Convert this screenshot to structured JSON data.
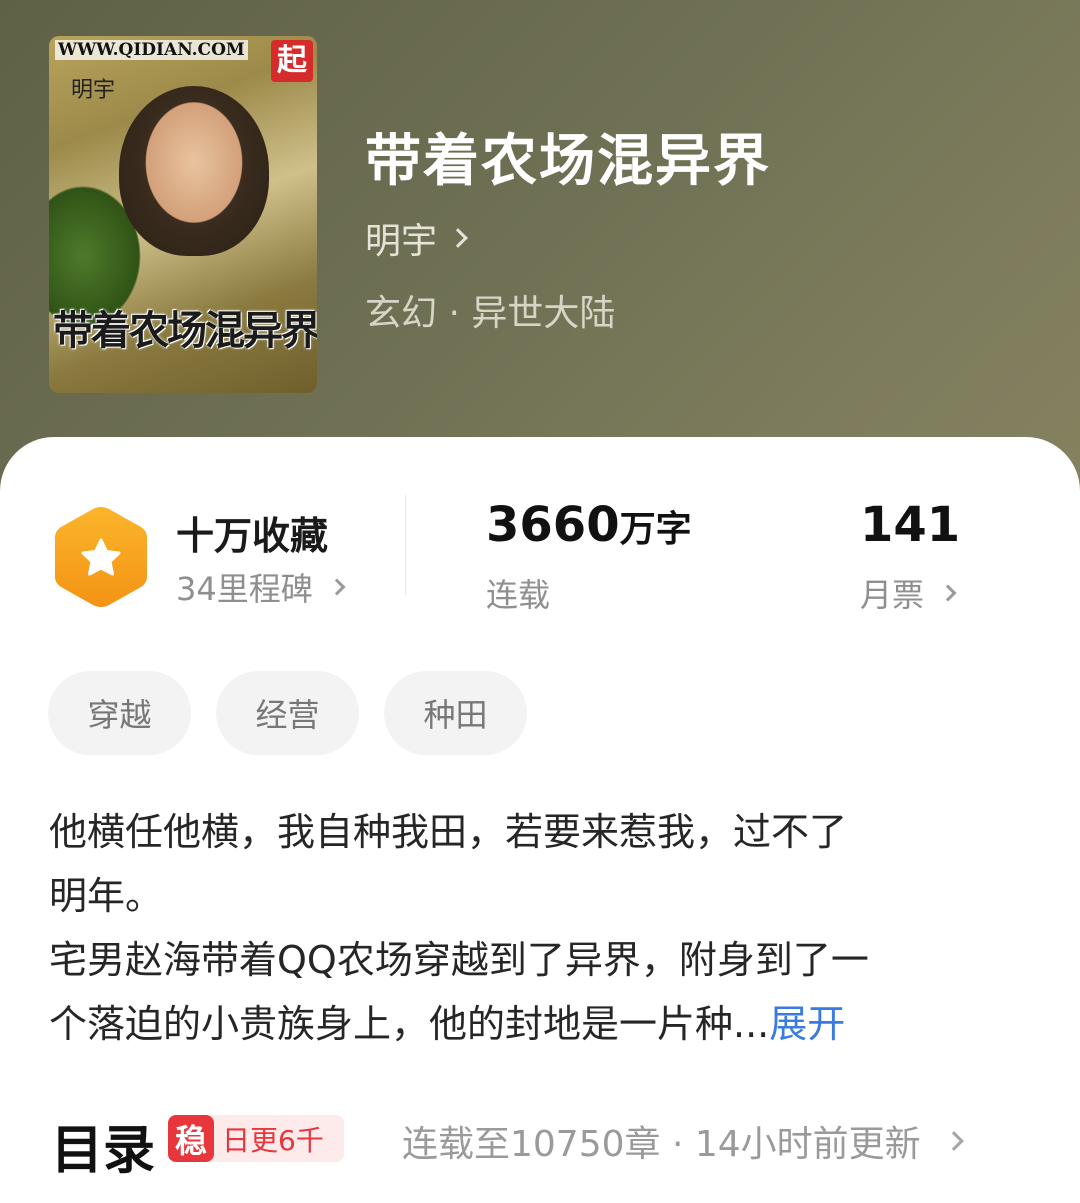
{
  "book": {
    "title": "带着农场混异界",
    "author": "明宇",
    "genre": "玄幻 · 异世大陆"
  },
  "cover": {
    "site": "WWW.QIDIAN.COM",
    "logo": "起",
    "author": "明宇",
    "title": "带着农场混异界"
  },
  "stats": {
    "collections": {
      "label": "十万收藏",
      "sub": "34里程碑"
    },
    "words": {
      "number": "3660",
      "unit": "万字",
      "status": "连载"
    },
    "tickets": {
      "number": "141",
      "label": "月票"
    }
  },
  "tags": [
    "穿越",
    "经营",
    "种田"
  ],
  "description": {
    "line1": "他横任他横，我自种我田，若要来惹我，过不了",
    "line2": "明年。",
    "line3": "宅男赵海带着QQ农场穿越到了异界，附身到了一",
    "line4": "个落迫的小贵族身上，他的封地是一片种...",
    "expand": "展开"
  },
  "toc": {
    "title": "目录",
    "badge_mark": "稳",
    "badge_text": "日更6千",
    "info": "连载至10750章 · 14小时前更新"
  },
  "colors": {
    "hero_bg": "#6e6f53",
    "badge_orange": "#f7a21b",
    "link_blue": "#3a7be0",
    "badge_red": "#e8363d"
  },
  "icons": [
    "chevron-right-icon",
    "star-hexagon-icon"
  ]
}
